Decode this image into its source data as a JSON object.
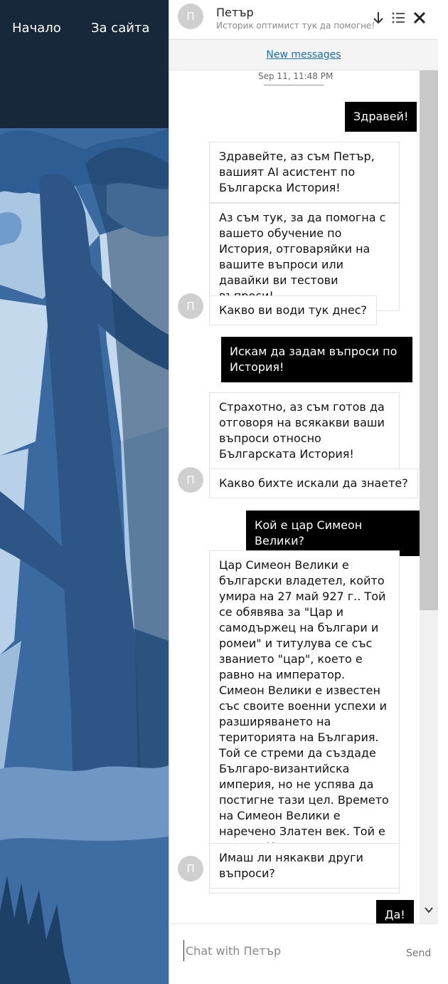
{
  "site": {
    "nav": {
      "home": "Начало",
      "about": "За сайта"
    }
  },
  "chat": {
    "agent_name": "Петър",
    "agent_subtitle": "Историк оптимист тук да помогне!",
    "avatar_initial": "П",
    "new_messages": "New messages",
    "timestamp": "Sep 11, 11:48 PM",
    "messages": [
      {
        "from": "user",
        "text": "Здравей!"
      },
      {
        "from": "bot",
        "text": "Здравейте, аз съм Петър, вашият AI асистент по Българска История!"
      },
      {
        "from": "bot",
        "text": "Аз съм тук, за да помогна с вашето обучение по История, отговаряйки на вашите въпроси или давайки ви тестови въпроси!"
      },
      {
        "from": "bot",
        "text": "Какво ви води тук днес?"
      },
      {
        "from": "user",
        "text": "Искам да задам въпроси по История!"
      },
      {
        "from": "bot",
        "text": "Страхотно, аз съм готов да отговоря на всякакви ваши въпроси относно Българската История!"
      },
      {
        "from": "bot",
        "text": "Какво бихте искали да знаете?"
      },
      {
        "from": "user",
        "text": "Кой е цар Симеон Велики?"
      },
      {
        "from": "bot",
        "text": "Цар Симеон Велики е български владетел, който умира на 27 май 927 г.. Той се обявява за \"Цар и самодържец на българи и ромеи\" и титулува се със званието \"цар\", което е равно на император. Симеон Велики е известен със своите военни успехи и разширяването на територията на България. Той се стреми да създаде Българо-византийска империя, но не успява да постигне тази цел. Времето на Симеон Велики е наречено Златен век. Той е част от Крумовата династия и вероятно е част от Дуло."
      },
      {
        "from": "bot",
        "text": "Имаш ли някакви други въпроси?"
      },
      {
        "from": "user",
        "text": "Да!"
      }
    ],
    "input_placeholder": "Chat with Петър",
    "send_label": "Send"
  },
  "colors": {
    "user_bubble": "#000000",
    "bot_bubble": "#ffffff",
    "link": "#1a6fb5",
    "site_bg": "#1a2b3d"
  },
  "icons": {
    "header": [
      "arrow-down-icon",
      "list-icon",
      "close-icon"
    ]
  }
}
